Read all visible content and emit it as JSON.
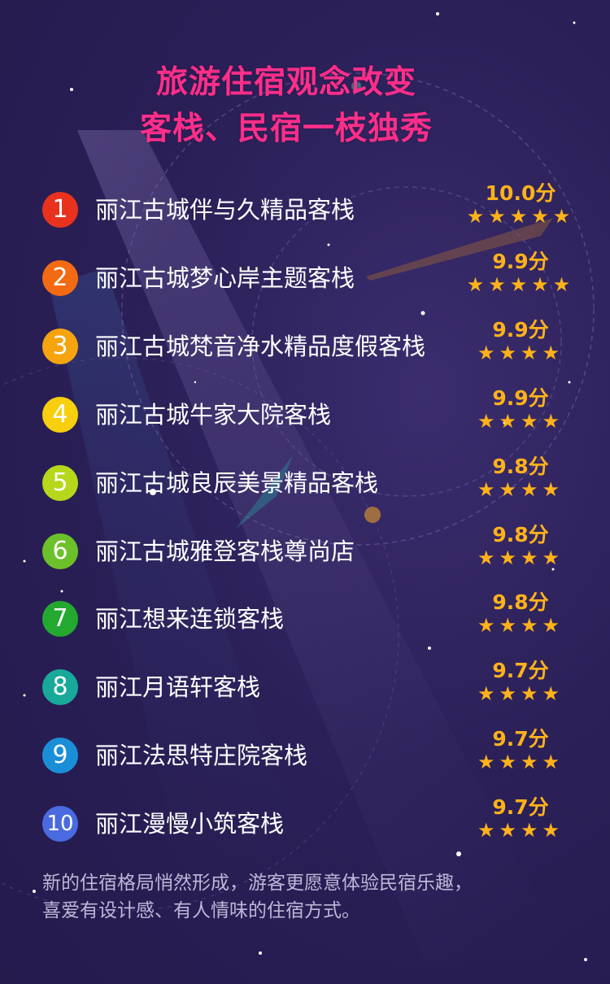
{
  "title": {
    "line1": "旅游住宿观念改变",
    "line2": "客栈、民宿一枝独秀"
  },
  "rankings": [
    {
      "rank": "1",
      "name": "丽江古城伴与久精品客栈",
      "score": "10.0分",
      "stars": 5,
      "badge_color": "#e8321e"
    },
    {
      "rank": "2",
      "name": "丽江古城梦心岸主题客栈",
      "score": "9.9分",
      "stars": 5,
      "badge_color": "#f26a12"
    },
    {
      "rank": "3",
      "name": "丽江古城梵音净水精品度假客栈",
      "score": "9.9分",
      "stars": 4,
      "badge_color": "#f5a30f"
    },
    {
      "rank": "4",
      "name": "丽江古城牛家大院客栈",
      "score": "9.9分",
      "stars": 4,
      "badge_color": "#f7cf0d"
    },
    {
      "rank": "5",
      "name": "丽江古城良辰美景精品客栈",
      "score": "9.8分",
      "stars": 4,
      "badge_color": "#b5d81a"
    },
    {
      "rank": "6",
      "name": "丽江古城雅登客栈尊尚店",
      "score": "9.8分",
      "stars": 4,
      "badge_color": "#6cc12a"
    },
    {
      "rank": "7",
      "name": "丽江想来连锁客栈",
      "score": "9.8分",
      "stars": 4,
      "badge_color": "#23a92f"
    },
    {
      "rank": "8",
      "name": "丽江月语轩客栈",
      "score": "9.7分",
      "stars": 4,
      "badge_color": "#18a99a"
    },
    {
      "rank": "9",
      "name": "丽江法思特庄院客栈",
      "score": "9.7分",
      "stars": 4,
      "badge_color": "#1a8fd8"
    },
    {
      "rank": "10",
      "name": "丽江漫慢小筑客栈",
      "score": "9.7分",
      "stars": 4,
      "badge_color": "#4a6ae0"
    }
  ],
  "footer": {
    "line1": "新的住宿格局悄然形成，游客更愿意体验民宿乐趣，",
    "line2": "喜爱有设计感、有人情味的住宿方式。"
  },
  "colors": {
    "title": "#ff2e8a",
    "score": "#ffb21a",
    "background": "#2a1f55"
  }
}
